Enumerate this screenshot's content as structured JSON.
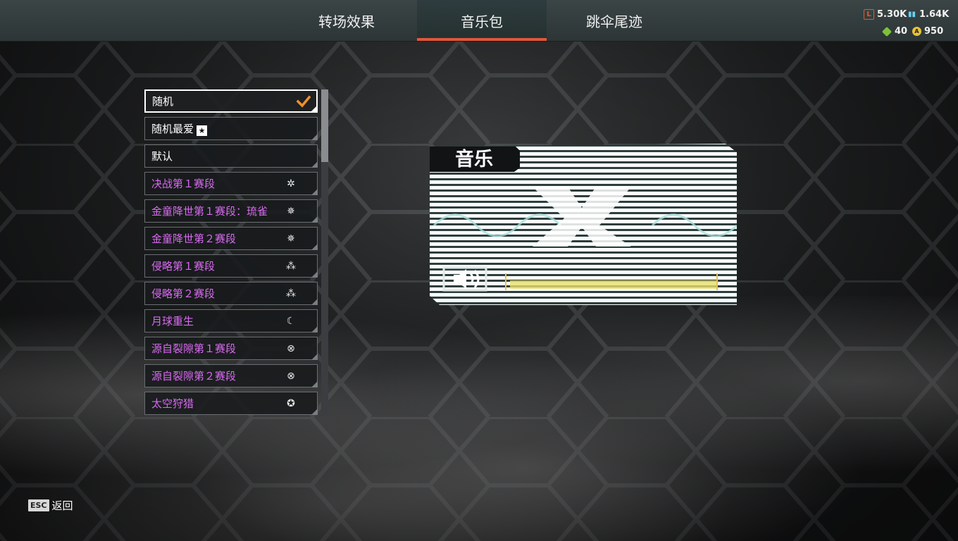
{
  "tabs": [
    {
      "label": "转场效果",
      "active": false
    },
    {
      "label": "音乐包",
      "active": true
    },
    {
      "label": "跳伞尾迹",
      "active": false
    }
  ],
  "currency": {
    "legend_tokens": "5.30K",
    "crafting_metals": "1.64K",
    "heirloom_shards": "40",
    "apex_coins": "950"
  },
  "list": {
    "items": [
      {
        "label": "随机",
        "selected": true,
        "event": false,
        "icon": "checkmark-icon"
      },
      {
        "label": "随机最爱",
        "selected": false,
        "event": false,
        "icon": "favorite-star-icon"
      },
      {
        "label": "默认",
        "selected": false,
        "event": false,
        "icon": ""
      },
      {
        "label": "决战第１赛段",
        "selected": false,
        "event": true,
        "icon": "battlepass-emblem-icon"
      },
      {
        "label": "金童降世第１赛段：琉雀",
        "selected": false,
        "event": true,
        "icon": "battlepass-emblem-icon"
      },
      {
        "label": "金童降世第２赛段",
        "selected": false,
        "event": true,
        "icon": "battlepass-emblem-icon"
      },
      {
        "label": "侵略第１赛段",
        "selected": false,
        "event": true,
        "icon": "battlepass-emblem-icon"
      },
      {
        "label": "侵略第２赛段",
        "selected": false,
        "event": true,
        "icon": "battlepass-emblem-icon"
      },
      {
        "label": "月球重生",
        "selected": false,
        "event": true,
        "icon": "battlepass-emblem-icon"
      },
      {
        "label": "源自裂隙第１赛段",
        "selected": false,
        "event": true,
        "icon": "battlepass-emblem-icon"
      },
      {
        "label": "源自裂隙第２赛段",
        "selected": false,
        "event": true,
        "icon": "battlepass-emblem-icon"
      },
      {
        "label": "太空狩猎",
        "selected": false,
        "event": true,
        "icon": "battlepass-emblem-icon"
      }
    ]
  },
  "preview": {
    "title": "音乐",
    "icon": "speaker-icon"
  },
  "footer": {
    "esc_key": "ESC",
    "back_label": "返回"
  },
  "colors": {
    "tab_accent": "#e2573a",
    "event_text": "#d86af0",
    "check": "#f0902a"
  }
}
